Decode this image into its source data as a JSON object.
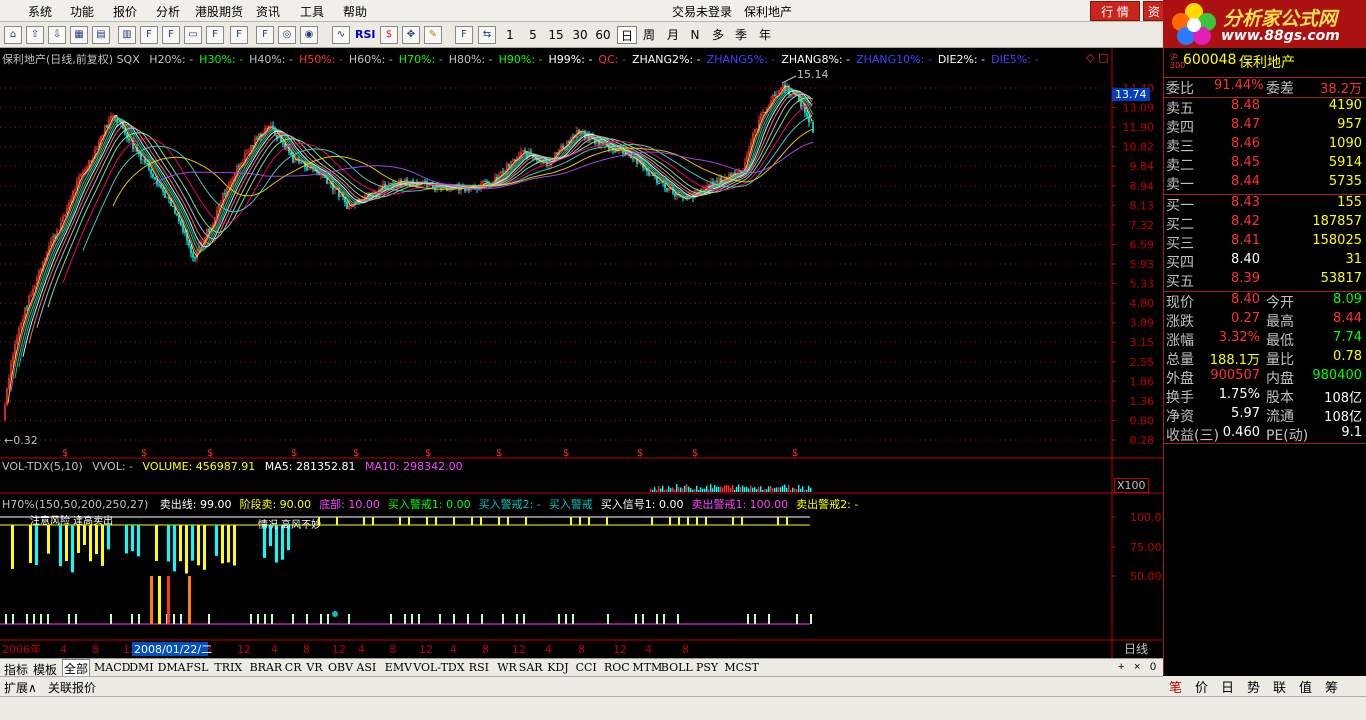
{
  "menu": {
    "items": [
      "系统",
      "功能",
      "报价",
      "分析",
      "港股期货",
      "资讯",
      "工具",
      "帮助"
    ],
    "login_status": "交易未登录",
    "stock_name": "保利地产",
    "hq_button": "行 情",
    "jy_button": "资"
  },
  "logo": {
    "title": "分析家公式网",
    "url": "www.88gs.com"
  },
  "toolbar": {
    "icons": [
      "home-icon",
      "back-icon",
      "up-icon",
      "down-icon",
      "table-icon",
      "grid-icon",
      "fn-icon",
      "fd-icon",
      "chart-icon",
      "ff-icon",
      "fiz-icon",
      "f10-icon",
      "compass-icon",
      "refresh-icon",
      "wave-icon"
    ],
    "rsi": "RSI",
    "periods": [
      "1",
      "5",
      "15",
      "30",
      "60",
      "日",
      "周",
      "月",
      "N",
      "多",
      "季",
      "年"
    ],
    "selected_period": "日"
  },
  "chart": {
    "header_title": "保利地产(日线,前复权) SQX",
    "header_items": [
      {
        "t": "H20%: -",
        "c": "#c0c0c0"
      },
      {
        "t": "H30%: -",
        "c": "#00ff00"
      },
      {
        "t": "H40%: -",
        "c": "#c0c0c0"
      },
      {
        "t": "H50%: -",
        "c": "#ff3030"
      },
      {
        "t": "H60%: -",
        "c": "#c0c0c0"
      },
      {
        "t": "H70%: -",
        "c": "#00ff00"
      },
      {
        "t": "H80%: -",
        "c": "#c0c0c0"
      },
      {
        "t": "H90%: -",
        "c": "#00ff00"
      },
      {
        "t": "H99%: -",
        "c": "#ffffff"
      },
      {
        "t": "QC: -",
        "c": "#ff3030"
      },
      {
        "t": "ZHANG2%: -",
        "c": "#ffffff"
      },
      {
        "t": "ZHANG5%: -",
        "c": "#4040ff"
      },
      {
        "t": "ZHANG8%: -",
        "c": "#ffffff"
      },
      {
        "t": "ZHANG10%: -",
        "c": "#4040ff"
      },
      {
        "t": "DIE2%: -",
        "c": "#ffffff"
      },
      {
        "t": "DIE5%: -",
        "c": "#4040ff"
      }
    ],
    "price_axis": [
      "14.40",
      "13.09",
      "11.90",
      "10.82",
      "9.84",
      "8.94",
      "8.13",
      "7.32",
      "6.59",
      "5.93",
      "5.33",
      "4.80",
      "3.89",
      "3.15",
      "2.55",
      "1.86",
      "1.36",
      "0.80",
      "0.28"
    ],
    "current_price_tag": "13.74",
    "high_label": "15.14",
    "low_label": "0.32",
    "dates": [
      "2006年",
      "4",
      "8",
      "12",
      "4",
      "8",
      "12",
      "4",
      "8",
      "12",
      "4",
      "8",
      "12",
      "4",
      "8",
      "12",
      "4",
      "8",
      "12",
      "4",
      "8"
    ],
    "cursor_date": "2008/01/22/二",
    "period_label": "日线"
  },
  "volume": {
    "title": "VOL-TDX(5,10)",
    "vvol": "VVOL: -",
    "volume": "VOLUME: 456987.91",
    "ma5": "MA5: 281352.81",
    "ma10": "MA10: 298342.00",
    "scale": "X100"
  },
  "indicator": {
    "title": "H70%(150,50,200,250,27)",
    "items": [
      {
        "t": "卖出线: 99.00",
        "c": "#ffffff"
      },
      {
        "t": "阶段卖: 90.00",
        "c": "#ffff00"
      },
      {
        "t": "底部: 10.00",
        "c": "#ff40ff"
      },
      {
        "t": "买入警戒1: 0.00",
        "c": "#00ff00"
      },
      {
        "t": "买入警戒2: -",
        "c": "#00c0c0"
      },
      {
        "t": "买入警戒",
        "c": "#00c0c0"
      },
      {
        "t": "买入信号1: 0.00",
        "c": "#ffffff"
      },
      {
        "t": "卖出警戒1: 100.00",
        "c": "#ff40ff"
      },
      {
        "t": "卖出警戒2: -",
        "c": "#ffff00"
      }
    ],
    "axis": [
      "100.0",
      "75.00",
      "50.00"
    ],
    "overlay_texts": [
      "注意风险 逢高卖出",
      "情况 高风不妙"
    ]
  },
  "tabs_bottom": {
    "left": [
      "指标",
      "模板",
      "全部"
    ],
    "indicators": [
      "MACD",
      "DMI",
      "DMA",
      "FSL",
      "TRIX",
      "BRAR",
      "CR",
      "VR",
      "OBV",
      "ASI",
      "EMV",
      "VOL-TDX",
      "RSI",
      "WR",
      "SAR",
      "KDJ",
      "CCI",
      "ROC",
      "MTM",
      "BOLL",
      "PSY",
      "MCST"
    ],
    "controls": [
      "+",
      "×",
      "0"
    ]
  },
  "tabs_foot": [
    "扩展∧",
    "关联报价"
  ],
  "right_tabs": [
    "笔",
    "价",
    "日",
    "势",
    "联",
    "值",
    "筹"
  ],
  "quote": {
    "tag": "沪300",
    "code": "600048",
    "name": "保利地产",
    "weibi_label": "委比",
    "weibi_value": "91.44%",
    "weicha_label": "委差",
    "weicha_value": "38.2万",
    "sells": [
      {
        "label": "卖五",
        "price": "8.48",
        "vol": "4190"
      },
      {
        "label": "卖四",
        "price": "8.47",
        "vol": "957"
      },
      {
        "label": "卖三",
        "price": "8.46",
        "vol": "1090"
      },
      {
        "label": "卖二",
        "price": "8.45",
        "vol": "5914"
      },
      {
        "label": "卖一",
        "price": "8.44",
        "vol": "5735"
      }
    ],
    "buys": [
      {
        "label": "买一",
        "price": "8.43",
        "vol": "155"
      },
      {
        "label": "买二",
        "price": "8.42",
        "vol": "187857"
      },
      {
        "label": "买三",
        "price": "8.41",
        "vol": "158025"
      },
      {
        "label": "买四",
        "price": "8.40",
        "vol": "31"
      },
      {
        "label": "买五",
        "price": "8.39",
        "vol": "53817"
      }
    ],
    "stats": [
      {
        "l": "现价",
        "v": "8.40",
        "vc": "#ff3030",
        "l2": "今开",
        "v2": "8.09",
        "v2c": "#00ff00"
      },
      {
        "l": "涨跌",
        "v": "0.27",
        "vc": "#ff3030",
        "l2": "最高",
        "v2": "8.44",
        "v2c": "#ff3030"
      },
      {
        "l": "涨幅",
        "v": "3.32%",
        "vc": "#ff3030",
        "l2": "最低",
        "v2": "7.74",
        "v2c": "#00ff00"
      },
      {
        "l": "总量",
        "v": "188.1万",
        "vc": "#ffff00",
        "l2": "量比",
        "v2": "0.78",
        "v2c": "#ffff00"
      },
      {
        "l": "外盘",
        "v": "900507",
        "vc": "#ff3030",
        "l2": "内盘",
        "v2": "980400",
        "v2c": "#00ff00"
      },
      {
        "l": "换手",
        "v": "1.75%",
        "vc": "#ffffff",
        "l2": "股本",
        "v2": "108亿",
        "v2c": "#ffffff"
      },
      {
        "l": "净资",
        "v": "5.97",
        "vc": "#ffffff",
        "l2": "流通",
        "v2": "108亿",
        "v2c": "#ffffff"
      },
      {
        "l": "收益(三)",
        "v": "0.460",
        "vc": "#ffffff",
        "l2": "PE(动)",
        "v2": "9.1",
        "v2c": "#ffffff"
      }
    ]
  },
  "colors": {
    "up": "#ff3030",
    "down": "#00ffff",
    "grid": "#a01010",
    "axis": "#c00000",
    "label": "#c0c0c0"
  }
}
